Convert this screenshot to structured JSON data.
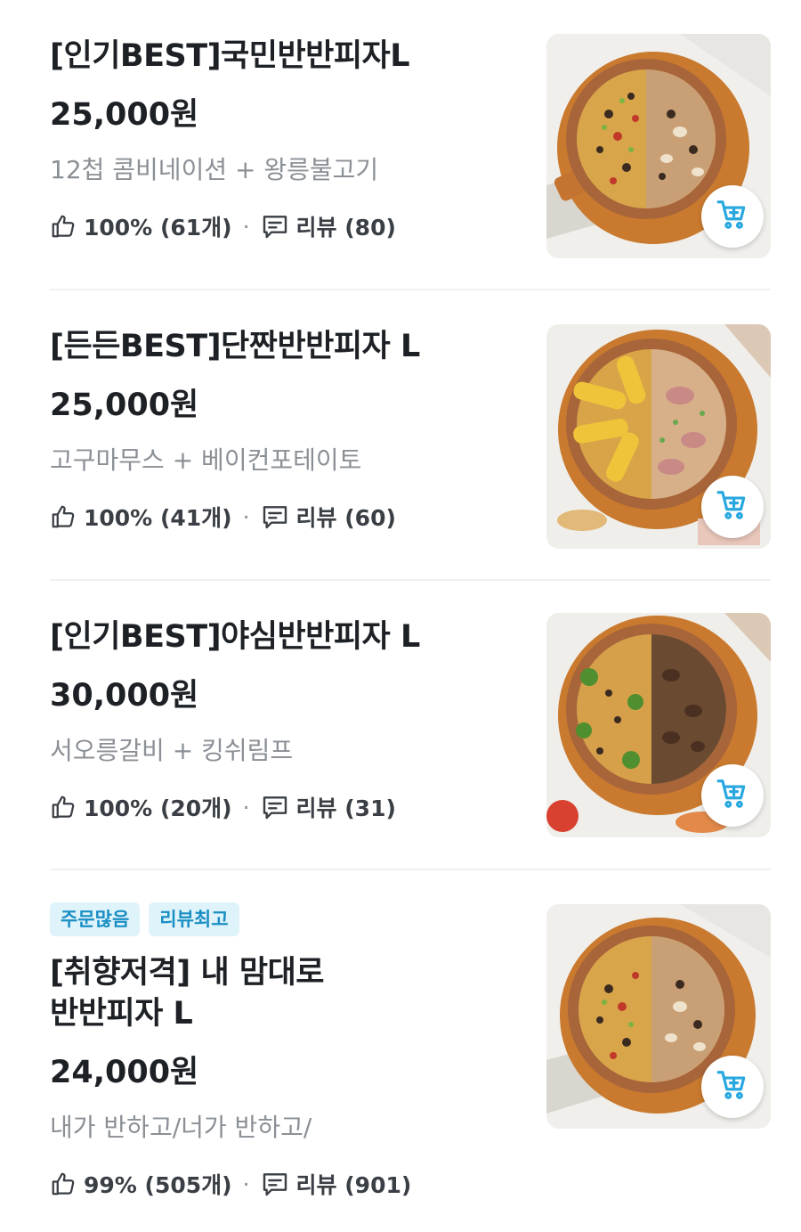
{
  "items": [
    {
      "title": "[인기BEST]국민반반피자L",
      "price": "25,000원",
      "description": "12첩 콤비네이션 + 왕릉불고기",
      "like_text": "100% (61개)",
      "review_text": "리뷰 (80)",
      "badges": [],
      "image": "combination-bulgogi-half-half-pizza"
    },
    {
      "title": "[든든BEST]단짠반반피자 L",
      "price": "25,000원",
      "description": "고구마무스 + 베이컨포테이토",
      "like_text": "100% (41개)",
      "review_text": "리뷰 (60)",
      "badges": [],
      "image": "sweetpotato-bacon-potato-half-half-pizza"
    },
    {
      "title": "[인기BEST]야심반반피자 L",
      "price": "30,000원",
      "description": "서오릉갈비 + 킹쉬림프",
      "like_text": "100% (20개)",
      "review_text": "리뷰 (31)",
      "badges": [],
      "image": "galbi-shrimp-half-half-pizza"
    },
    {
      "title": "[취향저격] 내 맘대로\n반반피자 L",
      "title_line1": "[취향저격] 내 맘대로",
      "title_line2": "반반피자 L",
      "price": "24,000원",
      "description": "내가 반하고/너가 반하고/",
      "like_text": "99% (505개)",
      "review_text": "리뷰 (901)",
      "badges": [
        "주문많음",
        "리뷰최고"
      ],
      "image": "custom-half-half-pizza"
    }
  ],
  "colors": {
    "accent": "#29a8e0",
    "badge_bg": "#dff3fb",
    "badge_text": "#1a8fc4",
    "muted_text": "#8b9096"
  },
  "icons": [
    "thumbs-up-icon",
    "review-bubble-icon",
    "add-to-cart-icon"
  ]
}
